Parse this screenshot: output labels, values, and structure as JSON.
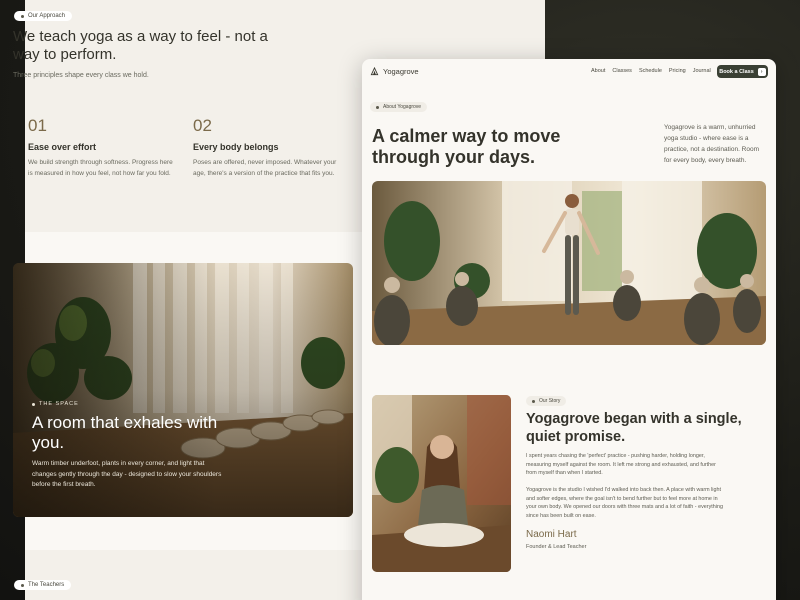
{
  "left": {
    "approach_pill": "Our Approach",
    "title": "We teach yoga as a way to feel - not a way to perform.",
    "subtitle": "Three principles shape every class we hold.",
    "principles": [
      {
        "num": "01",
        "title": "Ease over effort",
        "body": "We build strength through softness. Progress here is measured in how you feel, not how far you fold."
      },
      {
        "num": "02",
        "title": "Every body belongs",
        "body": "Poses are offered, never imposed. Whatever your age, there's a version of the practice that fits you."
      }
    ],
    "space": {
      "eyebrow": "THE SPACE",
      "title": "A room that exhales with you.",
      "body": "Warm timber underfoot, plants in every corner, and light that changes gently through the day - designed to slow your shoulders before the first breath."
    },
    "teachers_pill": "The Teachers"
  },
  "right": {
    "brand": "Yogagrove",
    "nav": [
      "About",
      "Classes",
      "Schedule",
      "Pricing",
      "Journal"
    ],
    "cta": "Book a Class",
    "about_pill": "About Yogagrove",
    "hero_title": "A calmer way to move through your days.",
    "hero_side": "Yogagrove is a warm, unhurried yoga studio - where ease is a practice, not a destination. Room for every body, every breath.",
    "story_pill": "Our Story",
    "story_title": "Yogagrove began with a single, quiet promise.",
    "story_p1": "I spent years chasing the 'perfect' practice - pushing harder, holding longer, measuring myself against the room. It left me strong and exhausted, and further from myself than when I started.",
    "story_p2": "Yogagrove is the studio I wished I'd walked into back then. A place with warm light and softer edges, where the goal isn't to bend further but to feel more at home in your own body. We opened our doors with three mats and a lot of faith - everything since has been built on ease.",
    "founder_name": "Naomi Hart",
    "founder_role": "Founder & Lead Teacher"
  },
  "colors": {
    "accent": "#7b6a4a",
    "button": "#3a4034",
    "background": "#faf8f4"
  }
}
